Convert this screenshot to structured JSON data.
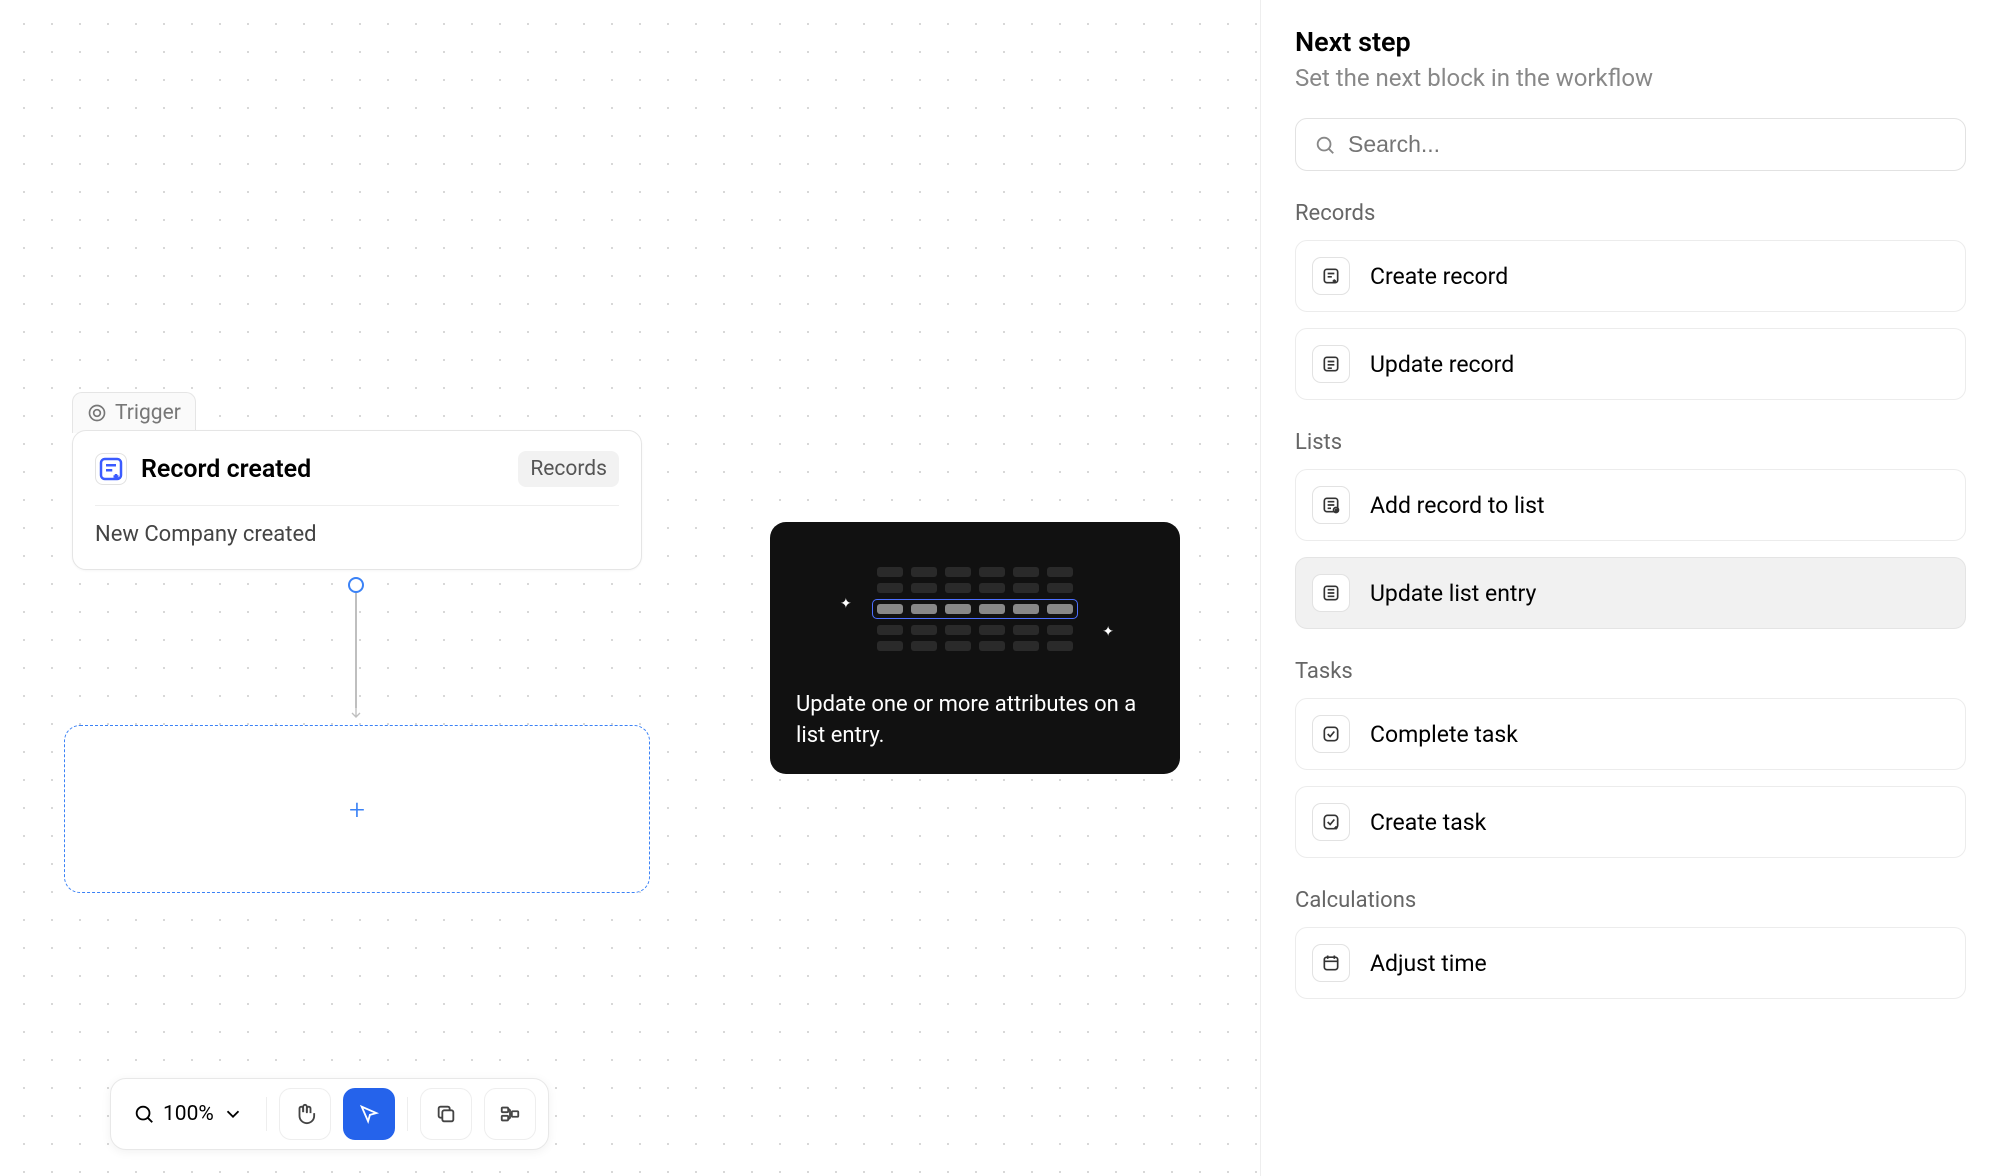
{
  "canvas": {
    "trigger_label": "Trigger",
    "node": {
      "title": "Record created",
      "tag": "Records",
      "subtitle": "New Company created"
    },
    "placeholder_plus": "+"
  },
  "tooltip": {
    "text": "Update one or more attributes on a list entry."
  },
  "toolbar": {
    "zoom": "100%"
  },
  "panel": {
    "title": "Next step",
    "subtitle": "Set the next block in the workflow",
    "search_placeholder": "Search...",
    "groups": [
      {
        "label": "Records",
        "options": [
          {
            "label": "Create record",
            "icon": "record-add"
          },
          {
            "label": "Update record",
            "icon": "record-update"
          }
        ]
      },
      {
        "label": "Lists",
        "options": [
          {
            "label": "Add record to list",
            "icon": "list-add"
          },
          {
            "label": "Update list entry",
            "icon": "list-update",
            "hover": true
          }
        ]
      },
      {
        "label": "Tasks",
        "options": [
          {
            "label": "Complete task",
            "icon": "task-check"
          },
          {
            "label": "Create task",
            "icon": "task-add"
          }
        ]
      },
      {
        "label": "Calculations",
        "options": [
          {
            "label": "Adjust time",
            "icon": "calendar"
          }
        ]
      }
    ]
  }
}
